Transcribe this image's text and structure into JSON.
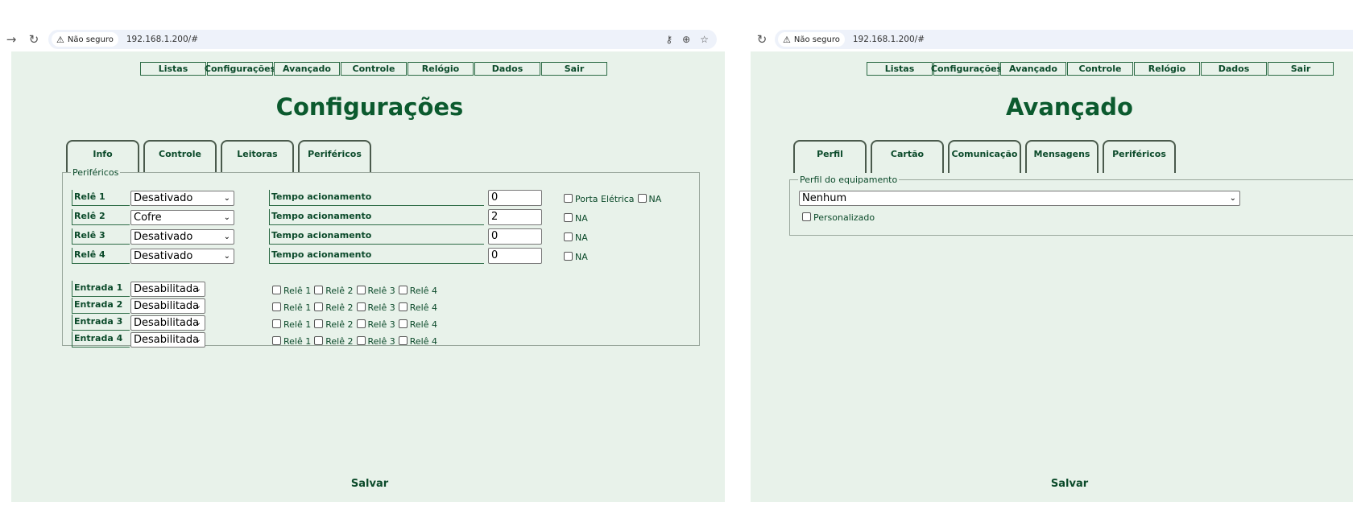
{
  "browser": {
    "not_secure": "Não seguro",
    "url": "192.168.1.200/#"
  },
  "left": {
    "menu": [
      "Listas",
      "Configurações",
      "Avançado",
      "Controle",
      "Relógio",
      "Dados",
      "Sair"
    ],
    "title": "Configurações",
    "tabs": [
      "Info",
      "Controle",
      "Leitoras",
      "Periféricos"
    ],
    "section_legend": "Periféricos",
    "relays": [
      {
        "label": "Relê 1",
        "mode": "Desativado",
        "time_label": "Tempo acionamento",
        "time_value": "0",
        "extra": "Porta Elétrica",
        "na": "NA"
      },
      {
        "label": "Relê 2",
        "mode": "Cofre",
        "time_label": "Tempo acionamento",
        "time_value": "2",
        "na": "NA"
      },
      {
        "label": "Relê 3",
        "mode": "Desativado",
        "time_label": "Tempo acionamento",
        "time_value": "0",
        "na": "NA"
      },
      {
        "label": "Relê 4",
        "mode": "Desativado",
        "time_label": "Tempo acionamento",
        "time_value": "0",
        "na": "NA"
      }
    ],
    "inputs": [
      {
        "label": "Entrada 1",
        "mode": "Desabilitada",
        "relays": [
          "Relê 1",
          "Relê 2",
          "Relê 3",
          "Relê 4"
        ]
      },
      {
        "label": "Entrada 2",
        "mode": "Desabilitada",
        "relays": [
          "Relê 1",
          "Relê 2",
          "Relê 3",
          "Relê 4"
        ]
      },
      {
        "label": "Entrada 3",
        "mode": "Desabilitada",
        "relays": [
          "Relê 1",
          "Relê 2",
          "Relê 3",
          "Relê 4"
        ]
      },
      {
        "label": "Entrada 4",
        "mode": "Desabilitada",
        "relays": [
          "Relê 1",
          "Relê 2",
          "Relê 3",
          "Relê 4"
        ]
      }
    ],
    "save_label": "Salvar"
  },
  "right": {
    "menu": [
      "Listas",
      "Configurações",
      "Avançado",
      "Controle",
      "Relógio",
      "Dados",
      "Sair"
    ],
    "title": "Avançado",
    "tabs": [
      "Perfil",
      "Cartão",
      "Comunicação",
      "Mensagens",
      "Periféricos"
    ],
    "section_legend": "Perfil do equipamento",
    "profile_value": "Nenhum",
    "custom_label": "Personalizado",
    "save_label": "Salvar"
  },
  "colors": {
    "page_bg": "#e8f2ea",
    "text_green": "#0b4a2a",
    "title_green": "#0b5a2e"
  }
}
